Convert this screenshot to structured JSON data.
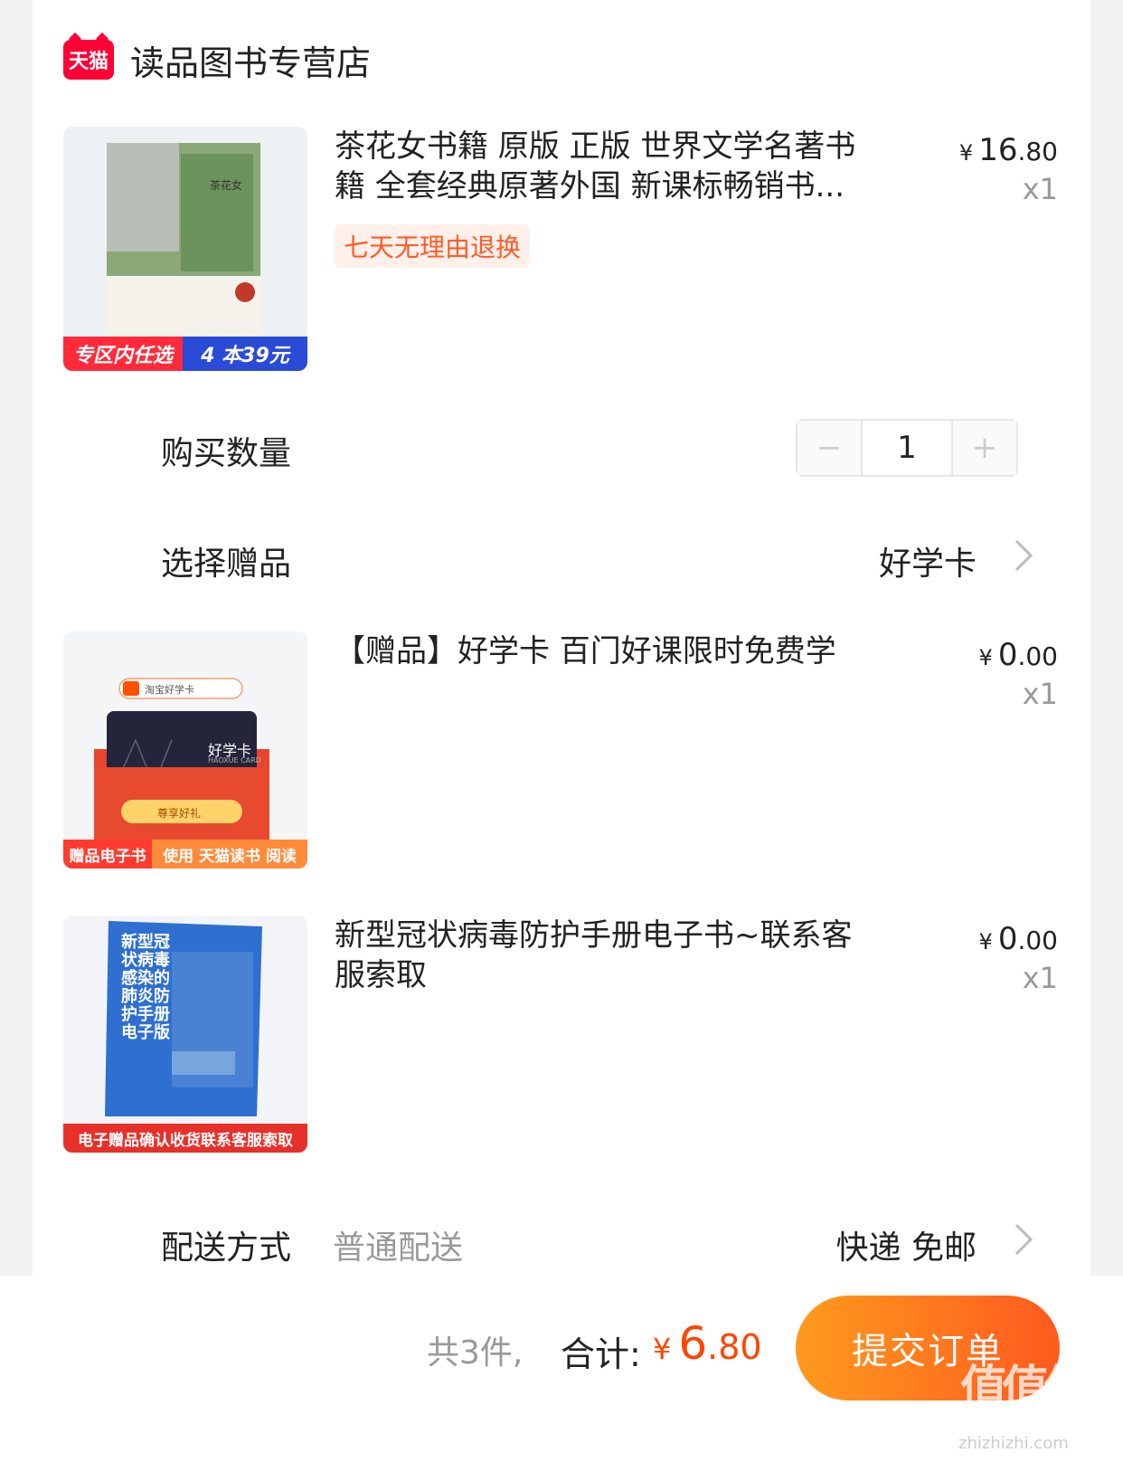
{
  "shop": {
    "badge": "天猫",
    "name": "读品图书专营店"
  },
  "items": [
    {
      "title": "茶花女书籍 原版 正版 世界文学名著书籍 全套经典原著外国 新课标畅销书...",
      "tag": "七天无理由退换",
      "price_yen": "¥",
      "price_int": "16",
      "price_dec": ".80",
      "qty": "x1",
      "thumb_cover_title": "茶花女",
      "thumb_banner_left": "专区内任选",
      "thumb_banner_right": "4 本39元"
    },
    {
      "title": "【赠品】好学卡 百门好课限时免费学",
      "price_yen": "¥",
      "price_int": "0",
      "price_dec": ".00",
      "qty": "x1",
      "thumb_search": "淘宝好学卡",
      "thumb_card_title": "好学卡",
      "thumb_card_sub": "HAOXUE CARD",
      "thumb_button": "尊享好礼",
      "thumb_banner_left": "赠品电子书",
      "thumb_banner_right": "使用 天猫读书 阅读"
    },
    {
      "title": "新型冠状病毒防护手册电子书~联系客服索取",
      "price_yen": "¥",
      "price_int": "0",
      "price_dec": ".00",
      "qty": "x1",
      "thumb_cover_text": "新型冠状病毒感染的肺炎防护手册电子版",
      "thumb_banner": "电子赠品确认收货联系客服索取"
    }
  ],
  "quantity": {
    "label": "购买数量",
    "value": "1",
    "minus": "−",
    "plus": "+"
  },
  "gift": {
    "label": "选择赠品",
    "value": "好学卡",
    "chevron": "chevron-right-icon"
  },
  "shipping": {
    "label": "配送方式",
    "method": "普通配送",
    "value": "快递 免邮",
    "chevron": "chevron-right-icon"
  },
  "footer": {
    "count": "共3件,",
    "total_label": "合计:",
    "total_yen": "¥",
    "total_int": "6",
    "total_dec": ".80",
    "submit": "提交订单"
  },
  "watermark": {
    "mark": "值值值",
    "site": "zhizhizhi.com"
  },
  "colors": {
    "accent": "#ff4400",
    "tmall": "#ff0036",
    "tag_text": "#ff5a2a"
  }
}
